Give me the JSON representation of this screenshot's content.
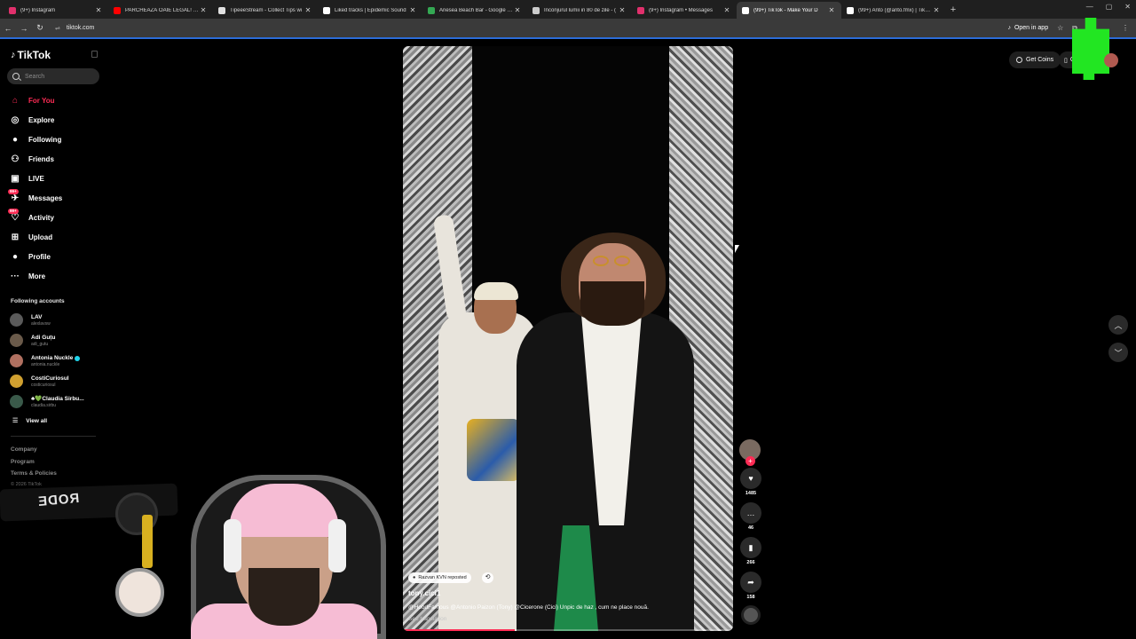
{
  "browser": {
    "tabs": [
      {
        "label": "(9+) Instagram",
        "color": "#e1306c",
        "active": false
      },
      {
        "label": "PARCHEAZĂ OAIE LEGAL! | Slay",
        "color": "#ff0000",
        "active": false
      },
      {
        "label": "TipeeeStream - Collect Tips wi",
        "color": "#e0e0e0",
        "active": false
      },
      {
        "label": "Liked tracks | Epidemic Sound",
        "color": "#ffffff",
        "active": false
      },
      {
        "label": "Anesea Beach Bar - Google Ma",
        "color": "#34a853",
        "active": false
      },
      {
        "label": "Inconjurul lumii in 80 de zile - (",
        "color": "#cccccc",
        "active": false
      },
      {
        "label": "(9+) Instagram • Messages",
        "color": "#e1306c",
        "active": false
      },
      {
        "label": "(99+) TikTok - Make Your D",
        "color": "#ffffff",
        "active": true
      },
      {
        "label": "(99+) Anto (@anto.fmx) | TikTok",
        "color": "#ffffff",
        "active": false
      }
    ],
    "url": "tiktok.com",
    "open_in_app": "Open in app"
  },
  "sidebar": {
    "logo": "TikTok",
    "search_placeholder": "Search",
    "nav": [
      {
        "label": "For You",
        "icon": "home-icon",
        "glyph": "⌂",
        "active": true
      },
      {
        "label": "Explore",
        "icon": "compass-icon",
        "glyph": "◎",
        "active": false
      },
      {
        "label": "Following",
        "icon": "following-icon",
        "glyph": "●",
        "active": false
      },
      {
        "label": "Friends",
        "icon": "friends-icon",
        "glyph": "⚇",
        "active": false
      },
      {
        "label": "LIVE",
        "icon": "live-icon",
        "glyph": "▣",
        "active": false
      },
      {
        "label": "Messages",
        "icon": "messages-icon",
        "glyph": "✈",
        "active": false,
        "badge": "99+"
      },
      {
        "label": "Activity",
        "icon": "activity-icon",
        "glyph": "♡",
        "active": false,
        "badge": "99+"
      },
      {
        "label": "Upload",
        "icon": "upload-icon",
        "glyph": "⊞",
        "active": false
      },
      {
        "label": "Profile",
        "icon": "profile-icon",
        "glyph": "●",
        "active": false
      },
      {
        "label": "More",
        "icon": "more-icon",
        "glyph": "···",
        "active": false
      }
    ],
    "following_title": "Following accounts",
    "accounts": [
      {
        "name": "LAV",
        "handle": "alexlavsw",
        "color": "#5a5a5a",
        "verified": false
      },
      {
        "name": "Adi Guțu",
        "handle": "adi_gutu",
        "color": "#6a5a4a",
        "verified": false
      },
      {
        "name": "Antonia Nuckle",
        "handle": "antonia.nuckle",
        "color": "#b07060",
        "verified": true
      },
      {
        "name": "CostiCuriosul",
        "handle": "costicuriosul",
        "color": "#d0a030",
        "verified": false
      },
      {
        "name": "♣💚Claudia Sirbu...",
        "handle": "claudia.sirbu",
        "color": "#3a5a4a",
        "verified": false
      }
    ],
    "view_all": "View all",
    "footer": [
      "Company",
      "Program",
      "Terms & Policies"
    ],
    "copyright": "© 2026 TikTok"
  },
  "video": {
    "repost_label": "Razvan KVN reposted",
    "author": "tony.cici1",
    "description": "@HoodFamous @Antonio Paizon (Tony) @Cicerone (Cici)   Unpic de haz , cum ne place nouă.",
    "see_translation": "See translation",
    "progress": 0.34
  },
  "actions": {
    "likes": "1485",
    "comments": "46",
    "saves": "266",
    "shares": "158"
  },
  "header": {
    "get_coins": "Get Coins",
    "get_app": "G"
  },
  "webcam": {
    "mic_brand": "RODE"
  }
}
